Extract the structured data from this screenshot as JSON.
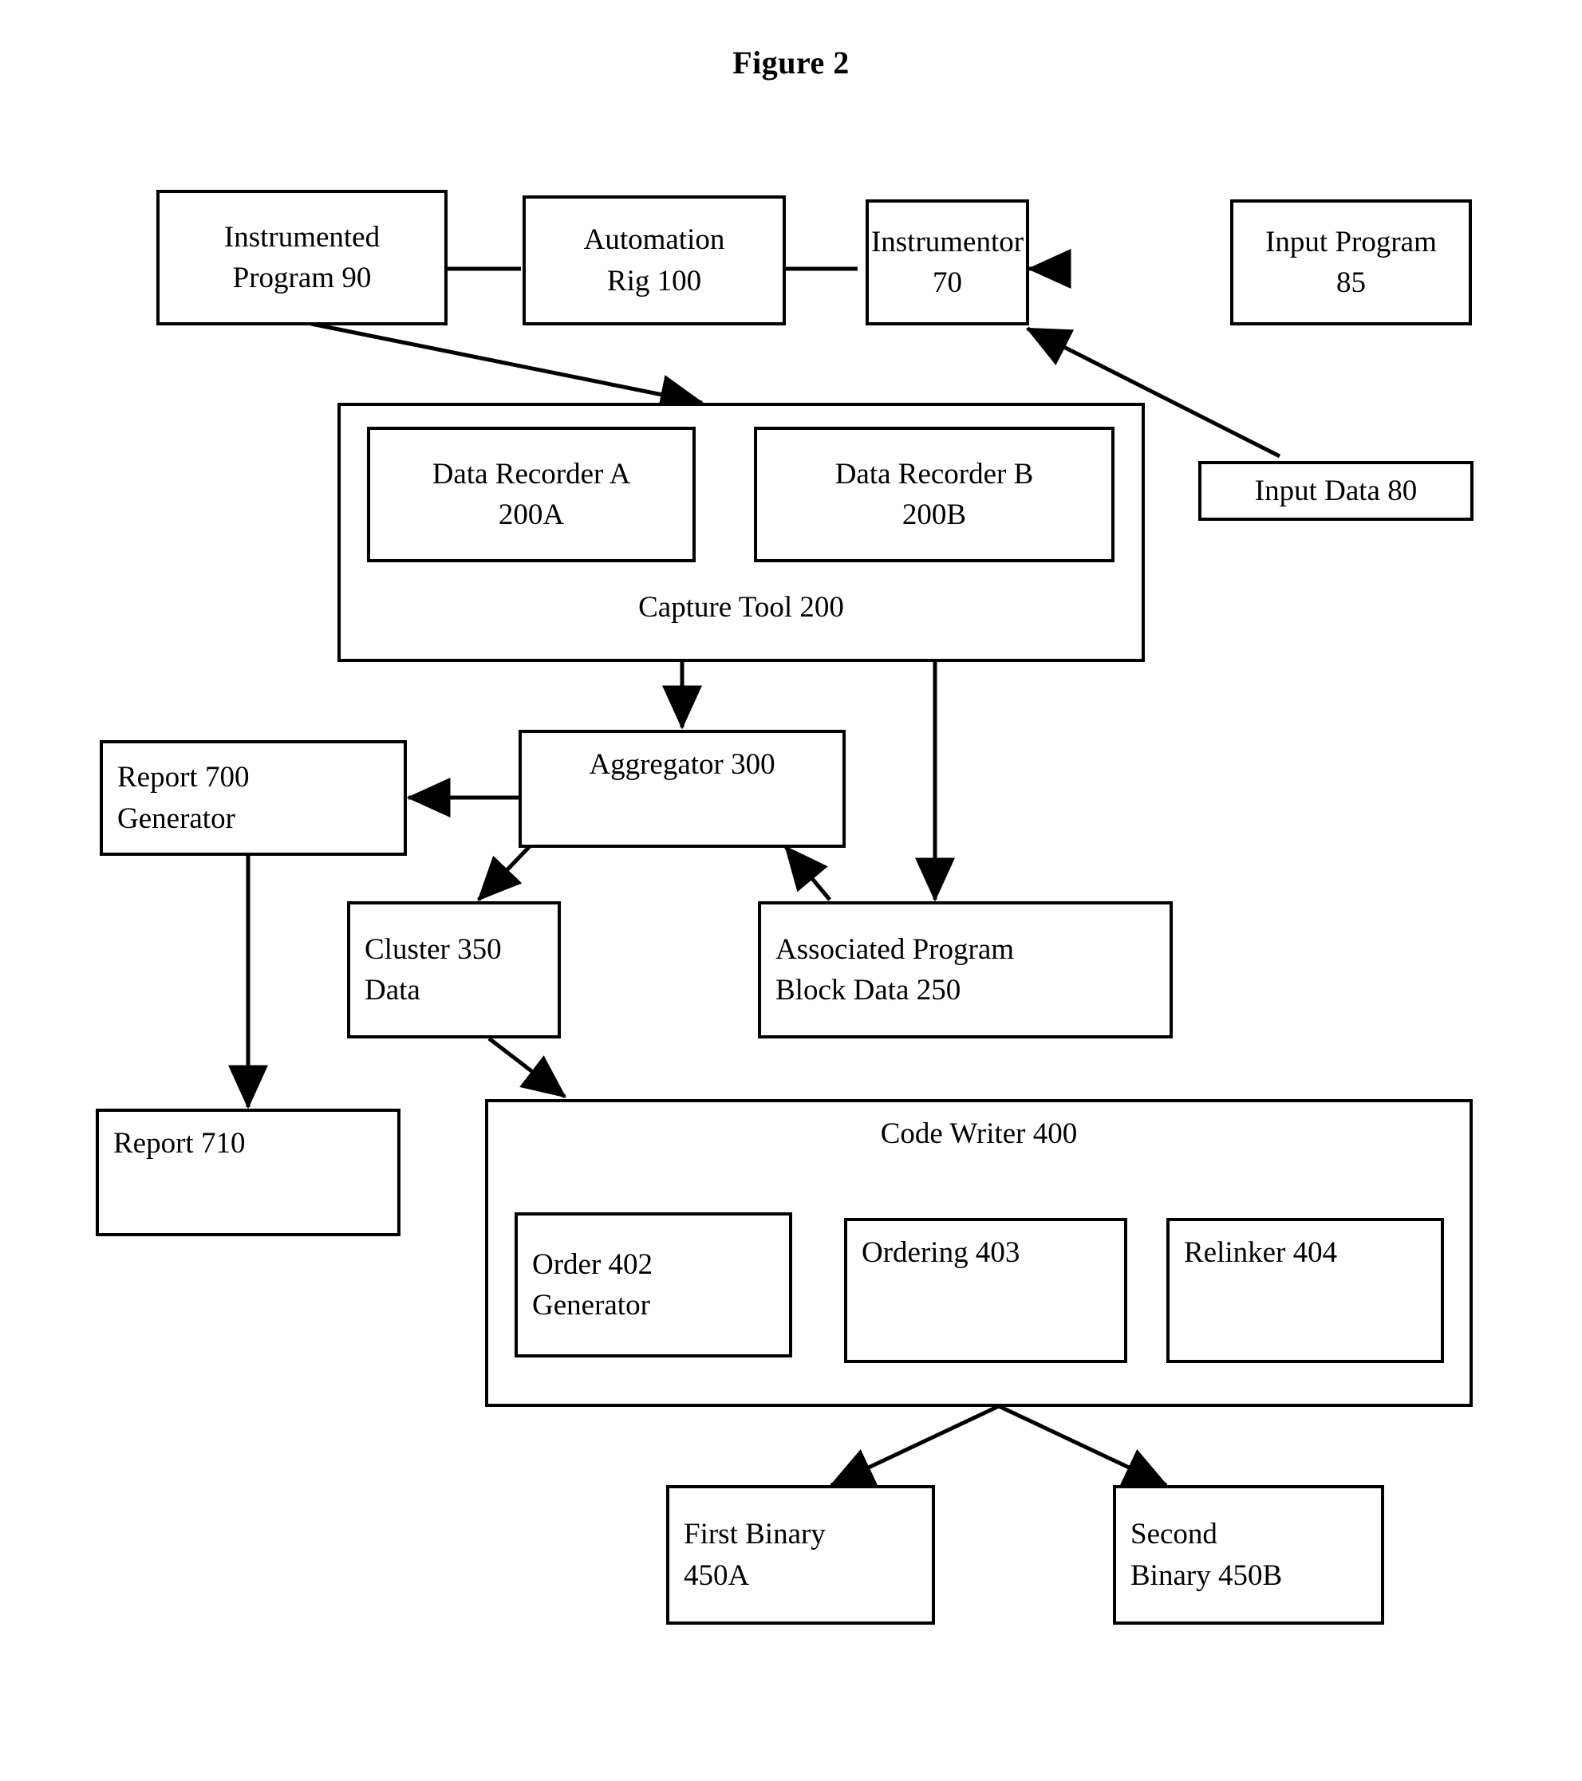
{
  "figure": {
    "title": "Figure 2"
  },
  "nodes": {
    "instrumented_program": {
      "line1": "Instrumented",
      "line2": "Program 90"
    },
    "automation_rig": {
      "line1": "Automation",
      "line2": "Rig 100"
    },
    "instrumentor": {
      "line1": "Instrumentor",
      "line2": "70"
    },
    "input_program": {
      "line1": "Input Program",
      "line2": "85"
    },
    "input_data": {
      "line1": "Input Data 80"
    },
    "capture_tool": {
      "label": "Capture Tool 200"
    },
    "data_recorder_a": {
      "line1": "Data Recorder A",
      "line2": "200A"
    },
    "data_recorder_b": {
      "line1": "Data Recorder B",
      "line2": "200B"
    },
    "aggregator": {
      "line1": "Aggregator 300"
    },
    "report_generator": {
      "line1": "Report 700",
      "line2": "Generator"
    },
    "report_710": {
      "line1": "Report 710"
    },
    "cluster_data": {
      "line1": "Cluster 350",
      "line2": "Data"
    },
    "associated_block_data": {
      "line1": "Associated Program",
      "line2": "Block Data 250"
    },
    "code_writer": {
      "label": "Code Writer 400"
    },
    "order_generator": {
      "line1": "Order 402",
      "line2": "Generator"
    },
    "ordering": {
      "line1": "Ordering 403"
    },
    "relinker": {
      "line1": "Relinker 404"
    },
    "first_binary": {
      "line1": "First Binary",
      "line2": "450A"
    },
    "second_binary": {
      "line1": "Second",
      "line2": "Binary 450B"
    }
  },
  "chart_data": {
    "type": "diagram",
    "title": "Figure 2",
    "diagram_kind": "block-flow-diagram",
    "blocks": [
      {
        "id": "instrumented_program",
        "label": "Instrumented Program 90"
      },
      {
        "id": "automation_rig",
        "label": "Automation Rig 100"
      },
      {
        "id": "instrumentor",
        "label": "Instrumentor 70"
      },
      {
        "id": "input_program",
        "label": "Input Program 85"
      },
      {
        "id": "input_data",
        "label": "Input Data 80"
      },
      {
        "id": "capture_tool",
        "label": "Capture Tool 200",
        "children": [
          "data_recorder_a",
          "data_recorder_b"
        ]
      },
      {
        "id": "data_recorder_a",
        "label": "Data Recorder A 200A"
      },
      {
        "id": "data_recorder_b",
        "label": "Data Recorder B 200B"
      },
      {
        "id": "aggregator",
        "label": "Aggregator 300"
      },
      {
        "id": "report_generator",
        "label": "Report 700 Generator"
      },
      {
        "id": "report_710",
        "label": "Report 710"
      },
      {
        "id": "cluster_data",
        "label": "Cluster 350 Data"
      },
      {
        "id": "associated_block_data",
        "label": "Associated Program Block Data 250"
      },
      {
        "id": "code_writer",
        "label": "Code Writer 400",
        "children": [
          "order_generator",
          "ordering",
          "relinker"
        ]
      },
      {
        "id": "order_generator",
        "label": "Order 402 Generator"
      },
      {
        "id": "ordering",
        "label": "Ordering 403"
      },
      {
        "id": "relinker",
        "label": "Relinker 404"
      },
      {
        "id": "first_binary",
        "label": "First Binary 450A"
      },
      {
        "id": "second_binary",
        "label": "Second Binary 450B"
      }
    ],
    "edges": [
      {
        "from": "input_program",
        "to": "instrumentor"
      },
      {
        "from": "input_data",
        "to": "instrumentor"
      },
      {
        "from": "instrumentor",
        "to": "automation_rig"
      },
      {
        "from": "automation_rig",
        "to": "instrumented_program"
      },
      {
        "from": "instrumented_program",
        "to": "capture_tool"
      },
      {
        "from": "capture_tool",
        "to": "aggregator"
      },
      {
        "from": "capture_tool",
        "to": "associated_block_data"
      },
      {
        "from": "aggregator",
        "to": "report_generator"
      },
      {
        "from": "aggregator",
        "to": "cluster_data"
      },
      {
        "from": "associated_block_data",
        "to": "aggregator"
      },
      {
        "from": "report_generator",
        "to": "report_710"
      },
      {
        "from": "cluster_data",
        "to": "code_writer"
      },
      {
        "from": "order_generator",
        "to": "ordering"
      },
      {
        "from": "ordering",
        "to": "relinker"
      },
      {
        "from": "code_writer",
        "to": "first_binary"
      },
      {
        "from": "code_writer",
        "to": "second_binary"
      }
    ]
  }
}
